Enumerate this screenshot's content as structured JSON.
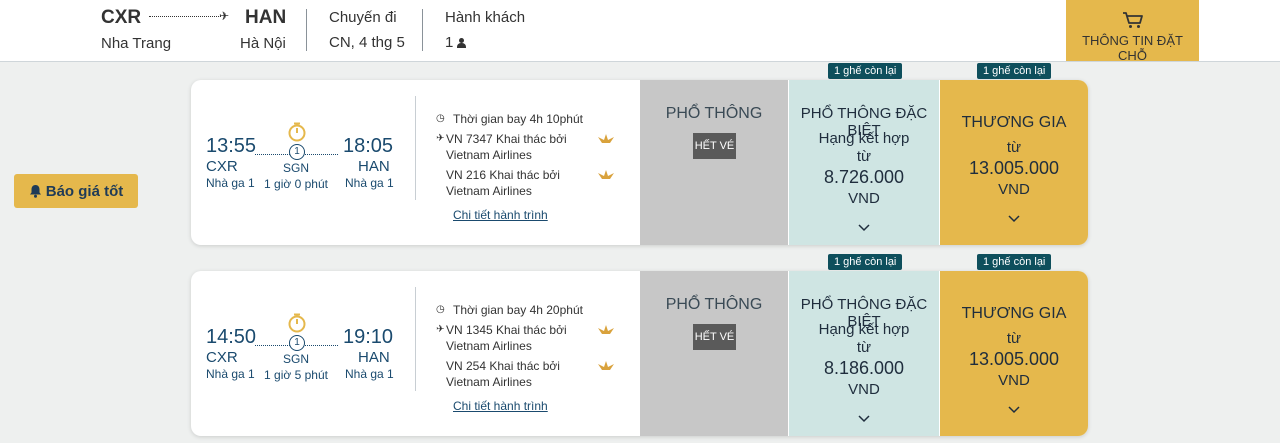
{
  "header": {
    "from_code": "CXR",
    "to_code": "HAN",
    "from_city": "Nha Trang",
    "to_city": "Hà Nội",
    "trip_label": "Chuyến đi",
    "trip_date": "CN, 4 thg 5",
    "pax_label": "Hành khách",
    "pax_count": "1",
    "booking_info_label": "THÔNG TIN ĐẶT CHỖ"
  },
  "alert_button": {
    "label": "Báo giá tốt"
  },
  "colors": {
    "accent": "#e5b84c",
    "badge": "#0e4f5c",
    "text": "#1a4a6e"
  },
  "flights": [
    {
      "depart_time": "13:55",
      "arrive_time": "18:05",
      "depart_code": "CXR",
      "arrive_code": "HAN",
      "depart_terminal": "Nhà ga 1",
      "arrive_terminal": "Nhà ga 1",
      "stops": "1",
      "stop_code": "SGN",
      "stop_duration": "1 giờ 0 phút",
      "duration": "Thời gian bay 4h 10phút",
      "segments": [
        "VN 7347 Khai thác bởi Vietnam Airlines",
        "VN 216 Khai thác bởi Vietnam Airlines"
      ],
      "detail_link": "Chi tiết hành trình",
      "economy": {
        "name": "PHỔ THÔNG",
        "status": "HẾT VÉ"
      },
      "deluxe": {
        "badge": "1 ghế còn lại",
        "name": "PHỔ THÔNG ĐẶC BIỆT",
        "sub": "Hạng kết hợp",
        "from": "từ",
        "price": "8.726.000",
        "currency": "VND"
      },
      "business": {
        "badge": "1 ghế còn lại",
        "name": "THƯƠNG GIA",
        "from": "từ",
        "price": "13.005.000",
        "currency": "VND"
      }
    },
    {
      "depart_time": "14:50",
      "arrive_time": "19:10",
      "depart_code": "CXR",
      "arrive_code": "HAN",
      "depart_terminal": "Nhà ga 1",
      "arrive_terminal": "Nhà ga 1",
      "stops": "1",
      "stop_code": "SGN",
      "stop_duration": "1 giờ 5 phút",
      "duration": "Thời gian bay 4h 20phút",
      "segments": [
        "VN 1345 Khai thác bởi Vietnam Airlines",
        "VN 254 Khai thác bởi Vietnam Airlines"
      ],
      "detail_link": "Chi tiết hành trình",
      "economy": {
        "name": "PHỔ THÔNG",
        "status": "HẾT VÉ"
      },
      "deluxe": {
        "badge": "1 ghế còn lại",
        "name": "PHỔ THÔNG ĐẶC BIỆT",
        "sub": "Hạng kết hợp",
        "from": "từ",
        "price": "8.186.000",
        "currency": "VND"
      },
      "business": {
        "badge": "1 ghế còn lại",
        "name": "THƯƠNG GIA",
        "from": "từ",
        "price": "13.005.000",
        "currency": "VND"
      }
    }
  ]
}
